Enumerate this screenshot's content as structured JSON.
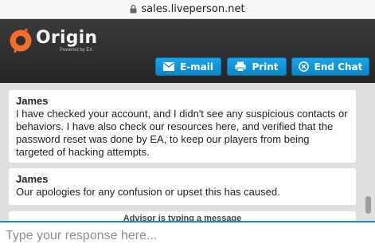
{
  "browser": {
    "url": "sales.liveperson.net"
  },
  "header": {
    "logo_word": "Origin",
    "logo_sub": "Powered by EA",
    "buttons": {
      "email": "E-mail",
      "print": "Print",
      "end_chat": "End Chat"
    }
  },
  "messages": [
    {
      "sender": "James",
      "text": "I have checked your account, and I didn't see any suspicious contacts or behaviors. I have also check our resources here, and verified that the password reset was done by EA, to keep our players from being targeted of hacking attempts."
    },
    {
      "sender": "James",
      "text": "Our apologies for any confusion or upset this has caused."
    }
  ],
  "typing_indicator": "Advisor is typing a message",
  "composer": {
    "placeholder": "Type your response here..."
  },
  "colors": {
    "accent": "#0d8fd4",
    "logo_orange": "#f56c2d",
    "header_bg": "#2e2e2e"
  }
}
